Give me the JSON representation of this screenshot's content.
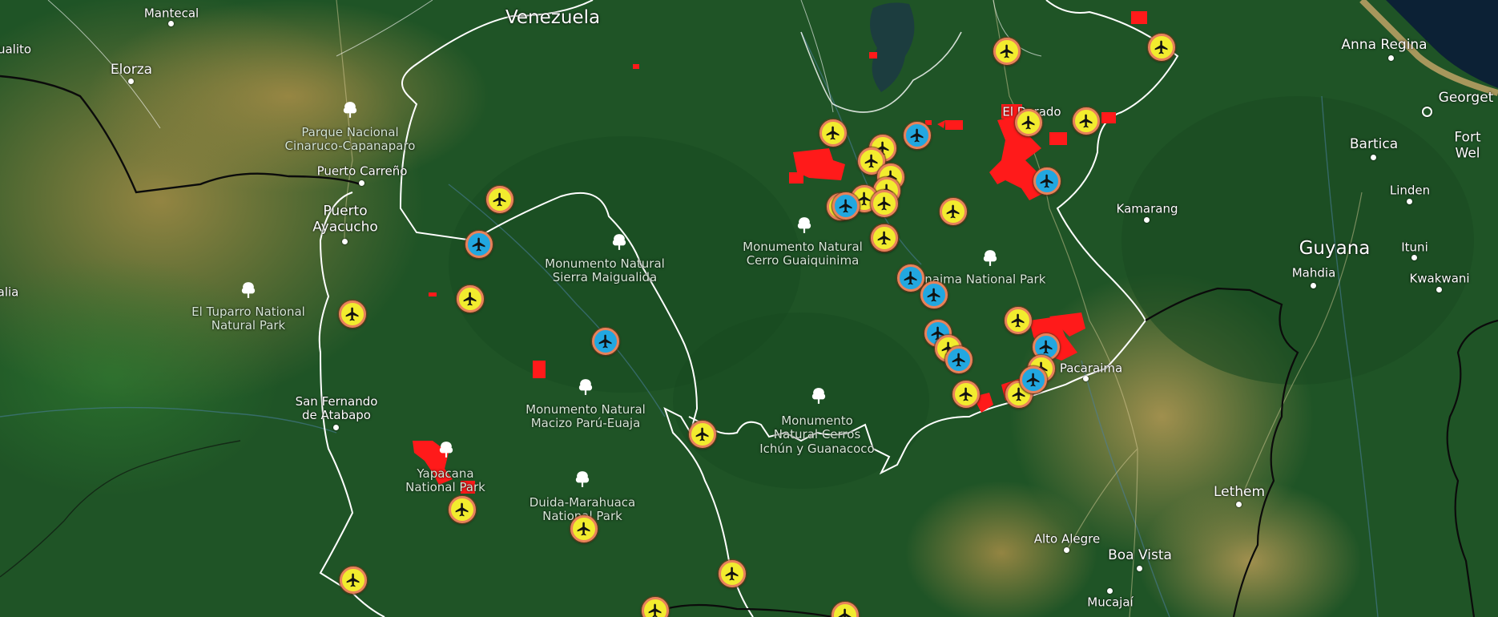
{
  "colors": {
    "forest": "#1f5a26",
    "savanna": "#8a7a3c",
    "ocean": "#0c2135",
    "border": "#ffffff",
    "fire_area": "#ff1a1a",
    "marker_yellow": "#f2ec2e",
    "marker_blue": "#22a7e0",
    "marker_ring": "#e8825a"
  },
  "labels": {
    "venezuela": "Venezuela",
    "guyana": "Guyana",
    "mantecal": "Mantecal",
    "elorza": "Elorza",
    "guasdualito_fragment": "ualito",
    "alia_fragment": "alia",
    "parque_cinaruco": "Parque Nacional\nCinaruco-Capanaparo",
    "puerto_carreno": "Puerto Carreño",
    "puerto_ayacucho": "Puerto\nAyacucho",
    "el_tuparro": "El Tuparro National\nNatural Park",
    "san_fernando": "San Fernando\nde Atabapo",
    "sierra_maigualida": "Monumento Natural\nSierra Maigualida",
    "cerro_guaiquinima": "Monumento Natural\nCerro Guaiquinima",
    "canaima": "Canaima National Park",
    "macizo_paru": "Monumento Natural\nMacizo Parú-Euaja",
    "ichun_guanacoco": "Monumento\nNatural Cerros\nIchún y Guanacoco",
    "yapacana": "Yapacana\nNational Park",
    "duida_marahuaca": "Duida-Marahuaca\nNational Park",
    "el_dorado": "El Dorado",
    "kamarang": "Kamarang",
    "pacaraima": "Pacaraima",
    "anna_regina": "Anna Regina",
    "georgetown_fragment": "Georget",
    "bartica": "Bartica",
    "fort_wellington_fragment": "Fort Wel",
    "linden": "Linden",
    "mahdia": "Mahdia",
    "ituni": "Ituni",
    "kwakwani": "Kwakwani",
    "lethem": "Lethem",
    "alto_alegre": "Alto Alegre",
    "boa_vista": "Boa Vista",
    "mucajai": "Mucajaí"
  },
  "airports": [
    {
      "type": "yellow",
      "id": "a1"
    },
    {
      "type": "yellow",
      "id": "a2"
    },
    {
      "type": "yellow",
      "id": "a3"
    },
    {
      "type": "yellow",
      "id": "a4"
    },
    {
      "type": "yellow",
      "id": "a5"
    },
    {
      "type": "blue",
      "id": "a6"
    },
    {
      "type": "yellow",
      "id": "a7"
    },
    {
      "type": "yellow",
      "id": "a8"
    },
    {
      "type": "yellow",
      "id": "a9"
    },
    {
      "type": "yellow",
      "id": "a10"
    },
    {
      "type": "yellow",
      "id": "a11"
    },
    {
      "type": "blue",
      "id": "a12"
    },
    {
      "type": "yellow",
      "id": "a13"
    },
    {
      "type": "yellow",
      "id": "a14"
    },
    {
      "type": "yellow",
      "id": "a15"
    },
    {
      "type": "yellow",
      "id": "a16"
    },
    {
      "type": "yellow",
      "id": "a17"
    },
    {
      "type": "blue",
      "id": "a18"
    },
    {
      "type": "yellow",
      "id": "a19"
    },
    {
      "type": "blue",
      "id": "a20"
    },
    {
      "type": "blue",
      "id": "a21"
    },
    {
      "type": "blue",
      "id": "a22"
    },
    {
      "type": "yellow",
      "id": "a23"
    },
    {
      "type": "blue",
      "id": "a24"
    },
    {
      "type": "yellow",
      "id": "a25"
    },
    {
      "type": "yellow",
      "id": "a26"
    },
    {
      "type": "blue",
      "id": "a27"
    },
    {
      "type": "yellow",
      "id": "a28"
    },
    {
      "type": "blue",
      "id": "a29"
    },
    {
      "type": "yellow",
      "id": "a30"
    },
    {
      "type": "yellow",
      "id": "a31"
    },
    {
      "type": "yellow",
      "id": "a32"
    },
    {
      "type": "blue",
      "id": "a33"
    },
    {
      "type": "yellow",
      "id": "a34"
    },
    {
      "type": "blue",
      "id": "a35"
    },
    {
      "type": "yellow",
      "id": "a36"
    },
    {
      "type": "yellow",
      "id": "a37"
    },
    {
      "type": "yellow",
      "id": "a38"
    },
    {
      "type": "yellow",
      "id": "a39"
    },
    {
      "type": "yellow",
      "id": "a40"
    },
    {
      "type": "yellow",
      "id": "a41"
    }
  ]
}
